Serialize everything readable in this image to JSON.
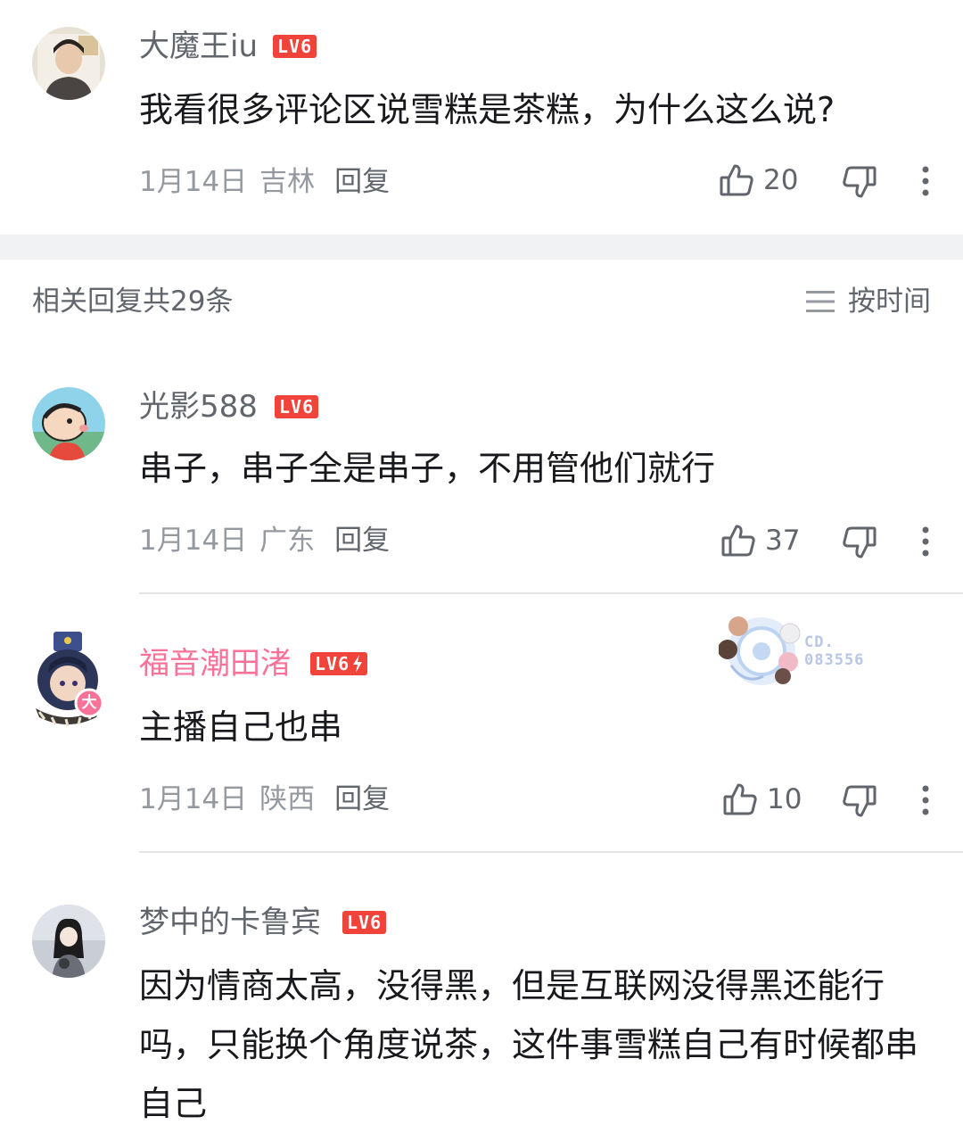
{
  "main_comment": {
    "username": "大魔王iu",
    "level": "LV6",
    "text": "我看很多评论区说雪糕是茶糕，为什么这么说?",
    "date": "1月14日",
    "location": "吉林",
    "reply_label": "回复",
    "likes": "20"
  },
  "replies_header": {
    "title": "相关回复共29条",
    "sort_label": "按时间"
  },
  "replies": [
    {
      "username": "光影588",
      "level": "LV6",
      "text": "串子，串子全是串子，不用管他们就行",
      "date": "1月14日",
      "location": "广东",
      "reply_label": "回复",
      "likes": "37"
    },
    {
      "username": "福音潮田渚",
      "level": "LV6",
      "text": "主播自己也串",
      "date": "1月14日",
      "location": "陕西",
      "reply_label": "回复",
      "likes": "10",
      "badge_text_line1": "CD.",
      "badge_text_line2": "083556",
      "avatar_badge": "大"
    },
    {
      "username": "梦中的卡鲁宾",
      "level": "LV6",
      "text": "因为情商太高，没得黑，但是互联网没得黑还能行吗，只能换个角度说茶，这件事雪糕自己有时候都串自己"
    }
  ],
  "colors": {
    "accent_pink": "#fb7299",
    "level_red": "#f0433a",
    "secondary_text": "#9499a0",
    "divider": "#e3e5e7"
  },
  "icons": [
    "thumb-up-icon",
    "thumb-down-icon",
    "more-icon",
    "sort-icon"
  ]
}
